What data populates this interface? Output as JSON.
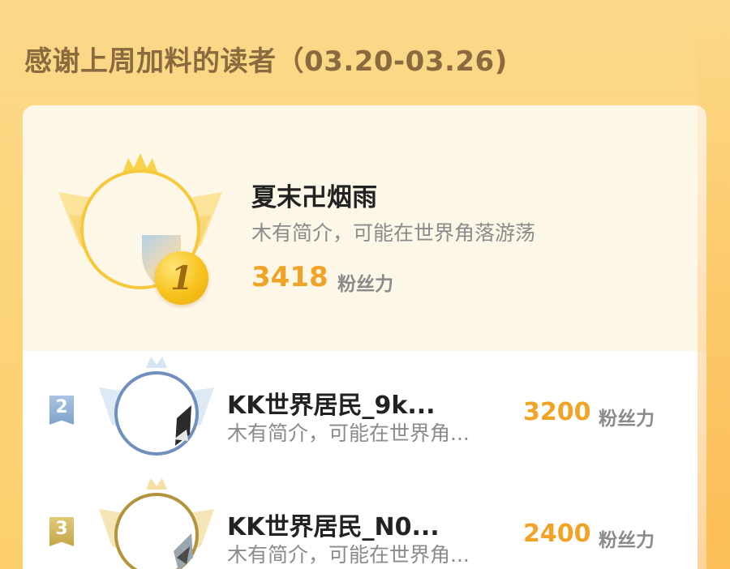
{
  "header": {
    "title": "感谢上周加料的读者（03.20-03.26)"
  },
  "top_reader": {
    "rank": "1",
    "name": "夏末卍烟雨",
    "bio": "木有简介，可能在世界角落游荡",
    "score": "3418",
    "score_unit": "粉丝力"
  },
  "readers": [
    {
      "rank": "2",
      "name": "KK世界居民_9k...",
      "bio": "木有简介，可能在世界角...",
      "score": "3200",
      "score_unit": "粉丝力"
    },
    {
      "rank": "3",
      "name": "KK世界居民_N0...",
      "bio": "木有简介，可能在世界角...",
      "score": "2400",
      "score_unit": "粉丝力"
    }
  ],
  "colors": {
    "gold": "#f7c21c",
    "silver": "#8aa3c4",
    "bronze": "#c9a24a",
    "score": "#f0a324"
  }
}
